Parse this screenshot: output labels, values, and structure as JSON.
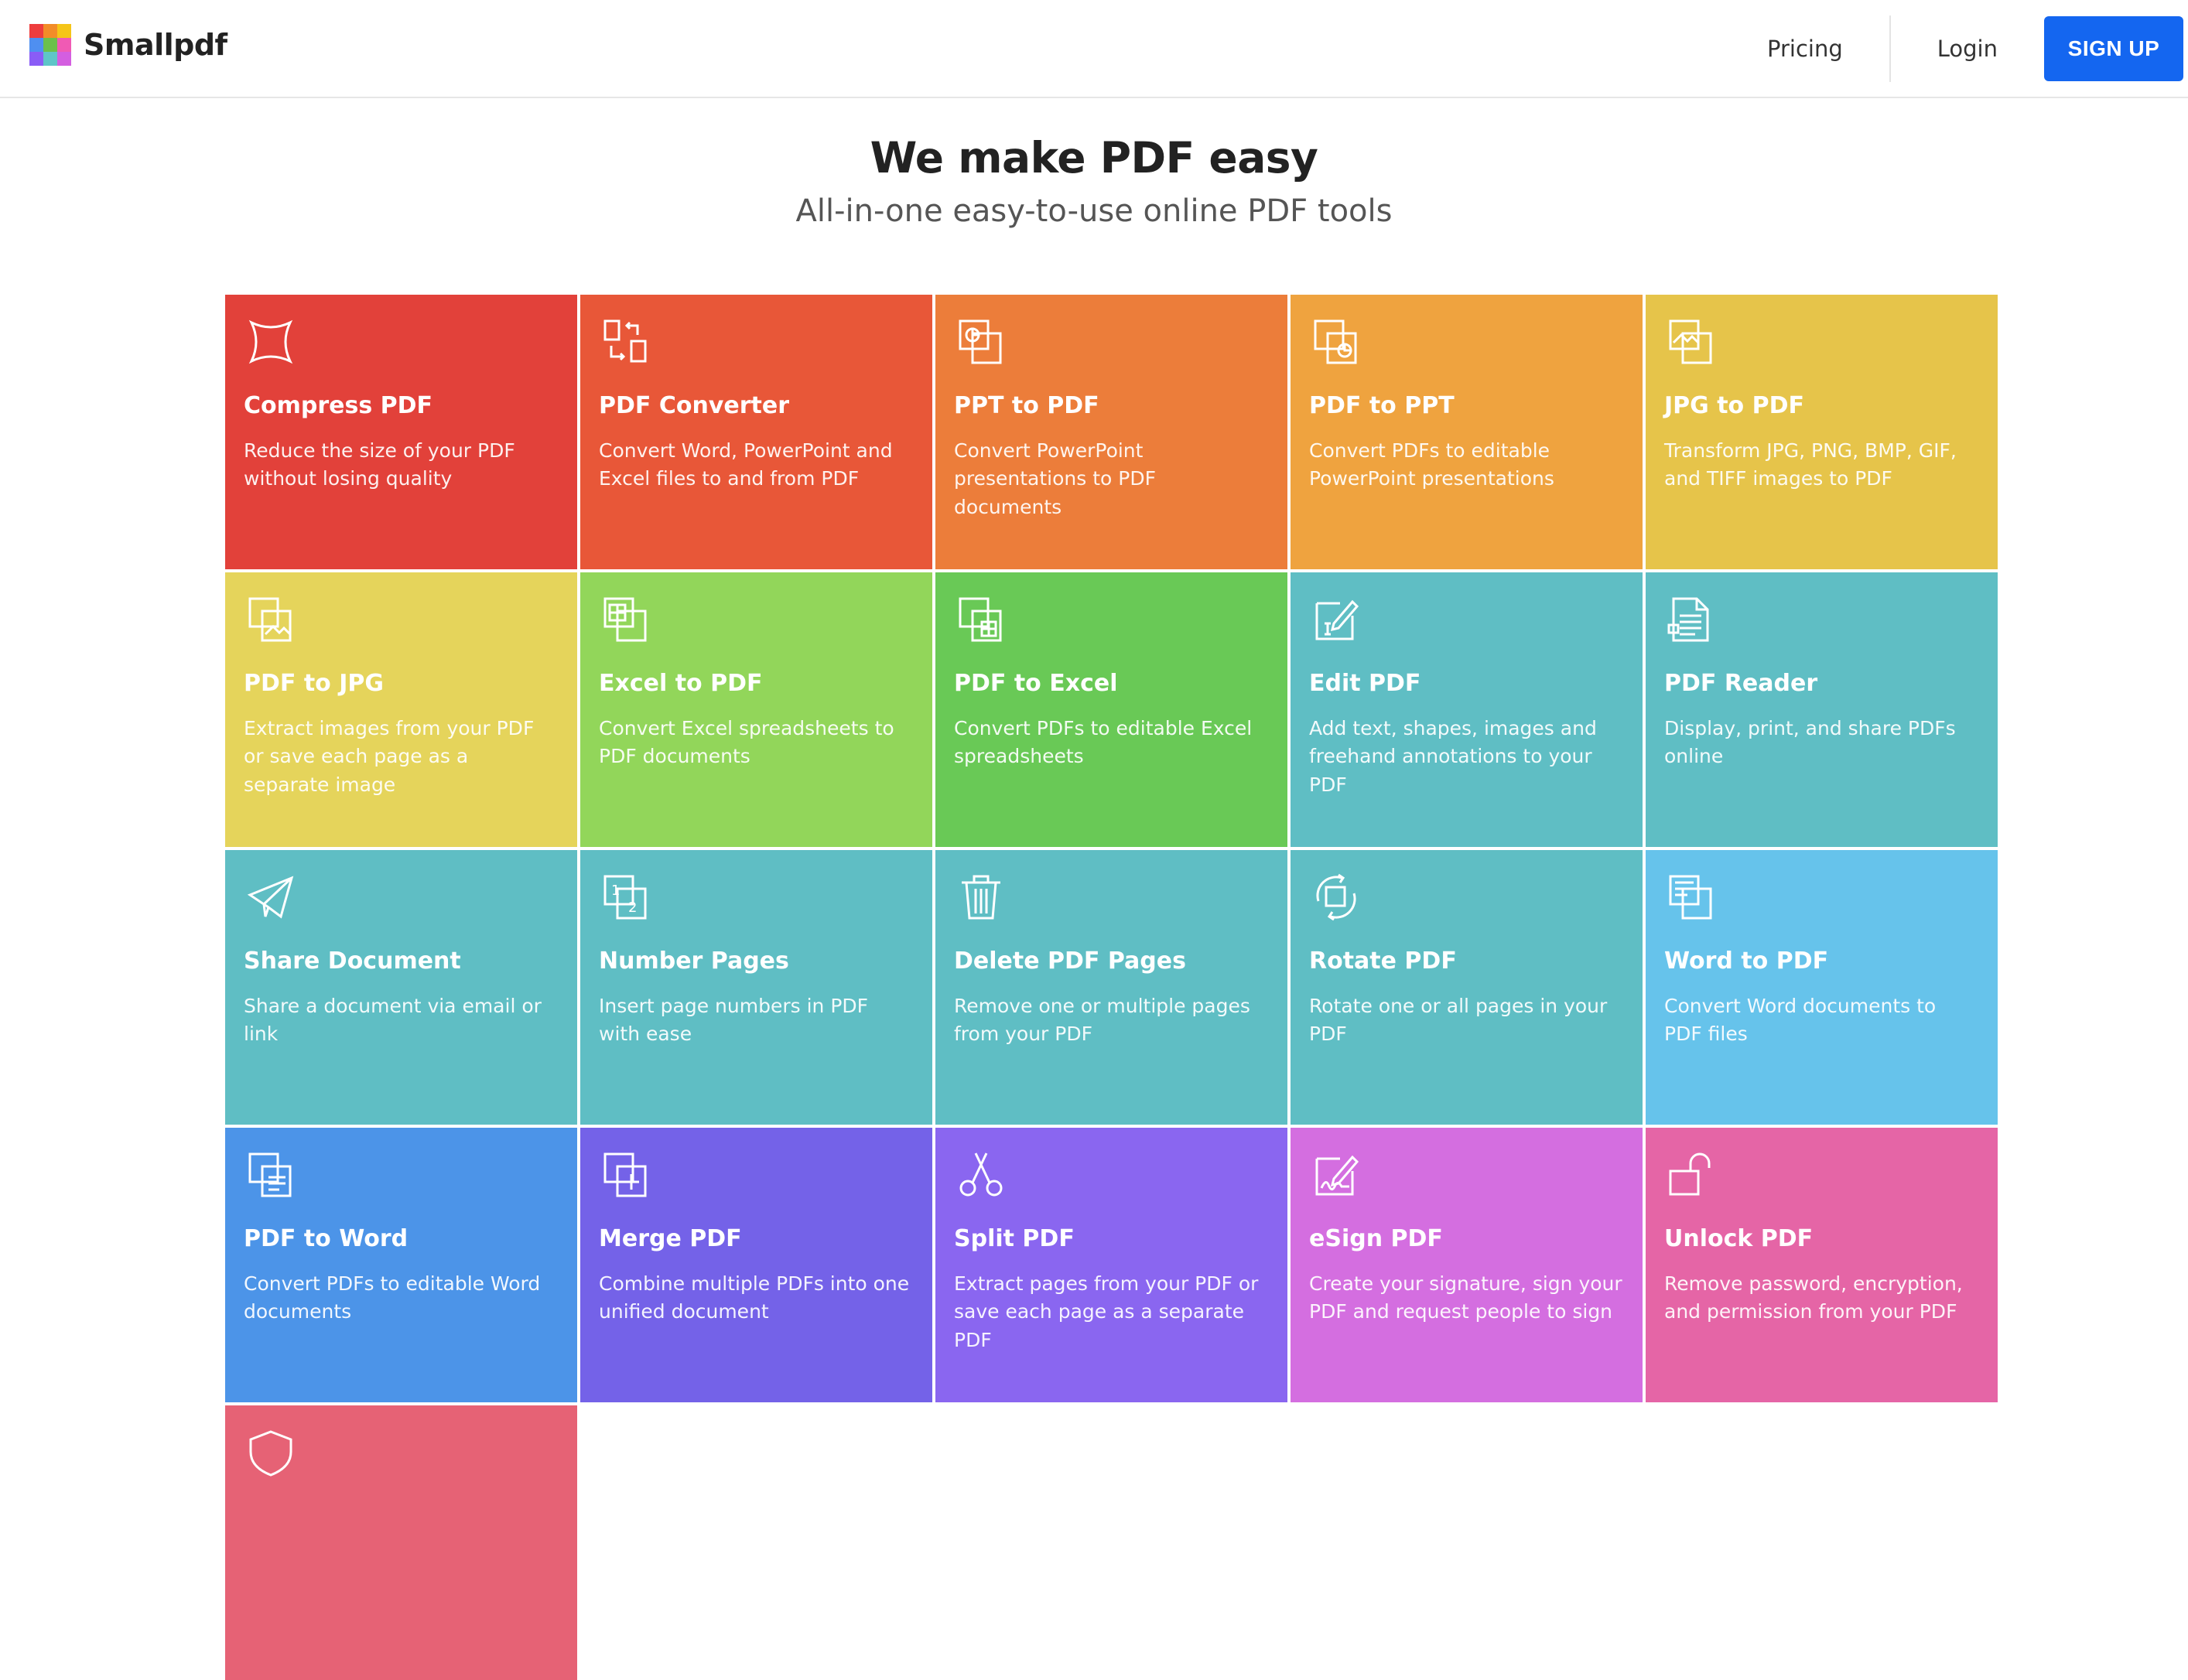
{
  "brand": {
    "name": "Smallpdf",
    "logo_colors": [
      "#ee3d3d",
      "#f28c28",
      "#f5c518",
      "#4f8ff0",
      "#6bc04b",
      "#f05ab4",
      "#8a5cf6",
      "#5ec5c8",
      "#d45ee0"
    ]
  },
  "nav": {
    "pricing": "Pricing",
    "login": "Login",
    "signup": "SIGN UP",
    "signup_color": "#1466f0"
  },
  "hero": {
    "title": "We make PDF easy",
    "subtitle": "All-in-one easy-to-use online PDF tools"
  },
  "tools": [
    {
      "title": "Compress PDF",
      "desc": "Reduce the size of your PDF without losing quality",
      "color": "#e2413a",
      "icon": "compress-icon"
    },
    {
      "title": "PDF Converter",
      "desc": "Convert Word, PowerPoint and Excel files to and from PDF",
      "color": "#e85738",
      "icon": "convert-icon"
    },
    {
      "title": "PPT to PDF",
      "desc": "Convert PowerPoint presentations to PDF documents",
      "color": "#ec7d3a",
      "icon": "ppt-icon"
    },
    {
      "title": "PDF to PPT",
      "desc": "Convert PDFs to editable PowerPoint presentations",
      "color": "#efa33f",
      "icon": "pdf-ppt-icon"
    },
    {
      "title": "JPG to PDF",
      "desc": "Transform JPG, PNG, BMP, GIF, and TIFF images to PDF",
      "color": "#e6c44a",
      "icon": "jpg-icon"
    },
    {
      "title": "PDF to JPG",
      "desc": "Extract images from your PDF or save each page as a separate image",
      "color": "#e5d45b",
      "icon": "pdf-jpg-icon"
    },
    {
      "title": "Excel to PDF",
      "desc": "Convert Excel spreadsheets to PDF documents",
      "color": "#92d65a",
      "icon": "excel-icon"
    },
    {
      "title": "PDF to Excel",
      "desc": "Convert PDFs to editable Excel spreadsheets",
      "color": "#69c956",
      "icon": "pdf-excel-icon"
    },
    {
      "title": "Edit PDF",
      "desc": "Add text, shapes, images and freehand annotations to your PDF",
      "color": "#5fbec4",
      "icon": "edit-icon"
    },
    {
      "title": "PDF Reader",
      "desc": "Display, print, and share PDFs online",
      "color": "#5fbec4",
      "icon": "reader-icon"
    },
    {
      "title": "Share Document",
      "desc": "Share a document via email or link",
      "color": "#5fbec4",
      "icon": "paper-plane-icon"
    },
    {
      "title": "Number Pages",
      "desc": "Insert page numbers in PDF with ease",
      "color": "#5fbec4",
      "icon": "number-icon"
    },
    {
      "title": "Delete PDF Pages",
      "desc": "Remove one or multiple pages from your PDF",
      "color": "#5fbec4",
      "icon": "trash-icon"
    },
    {
      "title": "Rotate PDF",
      "desc": "Rotate one or all pages in your PDF",
      "color": "#5fbec4",
      "icon": "rotate-icon"
    },
    {
      "title": "Word to PDF",
      "desc": "Convert Word documents to PDF files",
      "color": "#66c3eb",
      "icon": "word-icon"
    },
    {
      "title": "PDF to Word",
      "desc": "Convert PDFs to editable Word documents",
      "color": "#4c94e8",
      "icon": "pdf-word-icon"
    },
    {
      "title": "Merge PDF",
      "desc": "Combine multiple PDFs into one unified document",
      "color": "#7462e8",
      "icon": "merge-icon"
    },
    {
      "title": "Split PDF",
      "desc": "Extract pages from your PDF or save each page as a separate PDF",
      "color": "#8a66f0",
      "icon": "scissors-icon"
    },
    {
      "title": "eSign PDF",
      "desc": "Create your signature, sign your PDF and request people to sign",
      "color": "#d46ee0",
      "icon": "esign-icon"
    },
    {
      "title": "Unlock PDF",
      "desc": "Remove password, encryption, and permission from your PDF",
      "color": "#e565a6",
      "icon": "unlock-icon"
    },
    {
      "title": "",
      "desc": "",
      "color": "#e66275",
      "icon": "shield-icon"
    }
  ]
}
